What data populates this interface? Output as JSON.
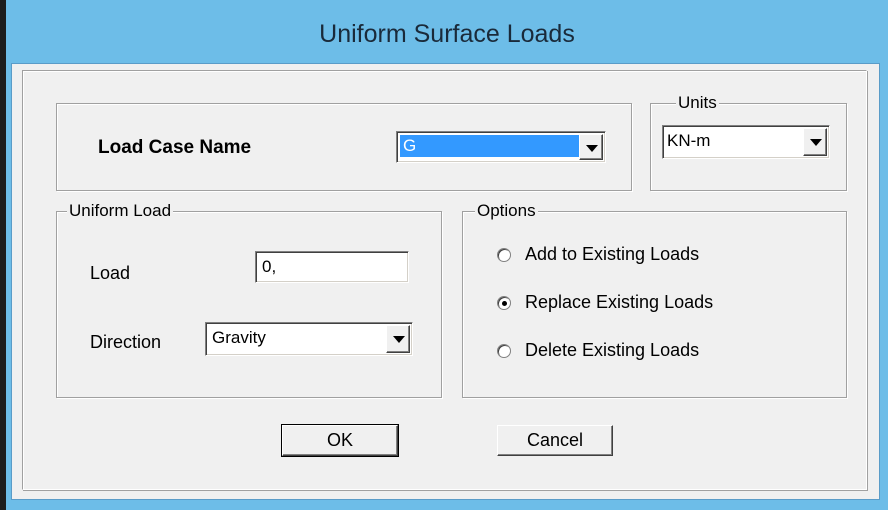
{
  "window": {
    "title": "Uniform Surface Loads"
  },
  "load_case": {
    "label": "Load Case Name",
    "selected": "G"
  },
  "units": {
    "legend": "Units",
    "selected": "KN-m"
  },
  "uniform_load": {
    "legend": "Uniform Load",
    "load_label": "Load",
    "load_value": "0,",
    "direction_label": "Direction",
    "direction_selected": "Gravity"
  },
  "options": {
    "legend": "Options",
    "items": [
      {
        "label": "Add to Existing Loads",
        "checked": false
      },
      {
        "label": "Replace Existing Loads",
        "checked": true
      },
      {
        "label": "Delete Existing Loads",
        "checked": false
      }
    ]
  },
  "buttons": {
    "ok": "OK",
    "cancel": "Cancel"
  }
}
